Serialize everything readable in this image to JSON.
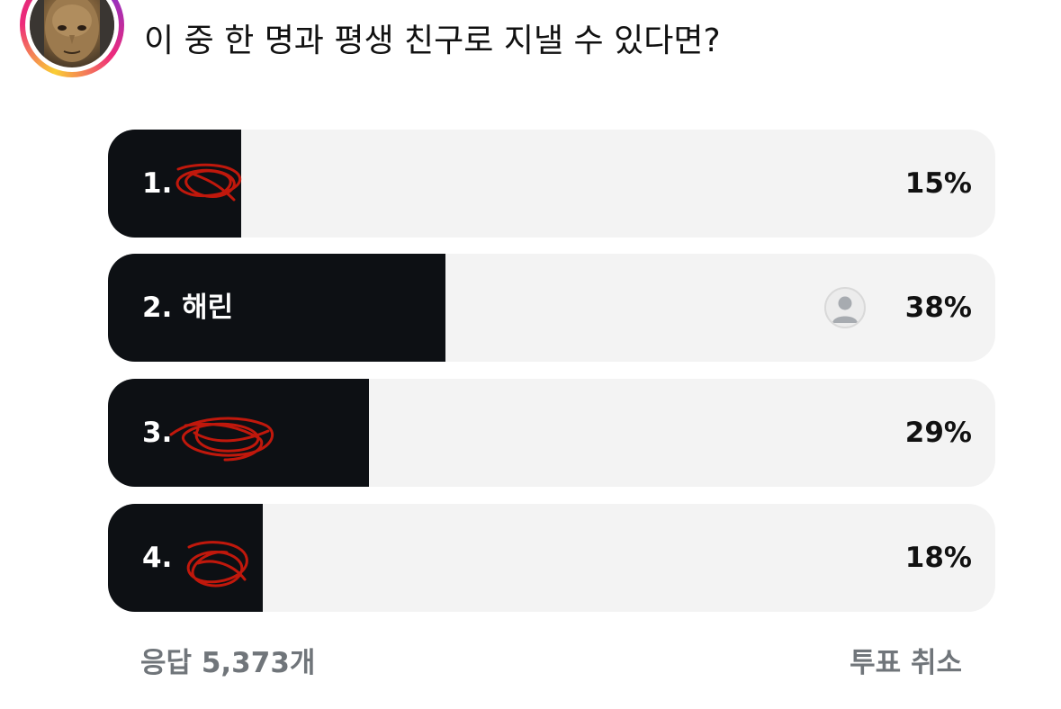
{
  "post": {
    "question": "이 중 한 명과 평생 친구로 지낼 수 있다면?"
  },
  "poll": {
    "options": [
      {
        "label": "1.",
        "percent_text": "15%",
        "percent": 15,
        "name_scribbled": true
      },
      {
        "label": "2. 해린",
        "percent_text": "38%",
        "percent": 38,
        "name_scribbled": false,
        "voted": true
      },
      {
        "label": "3.",
        "percent_text": "29%",
        "percent": 29,
        "name_scribbled": true
      },
      {
        "label": "4.",
        "percent_text": "18%",
        "percent": 18,
        "name_scribbled": true
      }
    ],
    "response_count": "응답 5,373개",
    "cancel_vote": "투표 취소"
  },
  "colors": {
    "bar_fill": "#0d1014",
    "bar_track": "#f3f3f3",
    "scribble": "#c0180c",
    "footer_text": "#70757a"
  },
  "icons": {
    "voter": "user-avatar-icon",
    "author": "profile-avatar"
  }
}
